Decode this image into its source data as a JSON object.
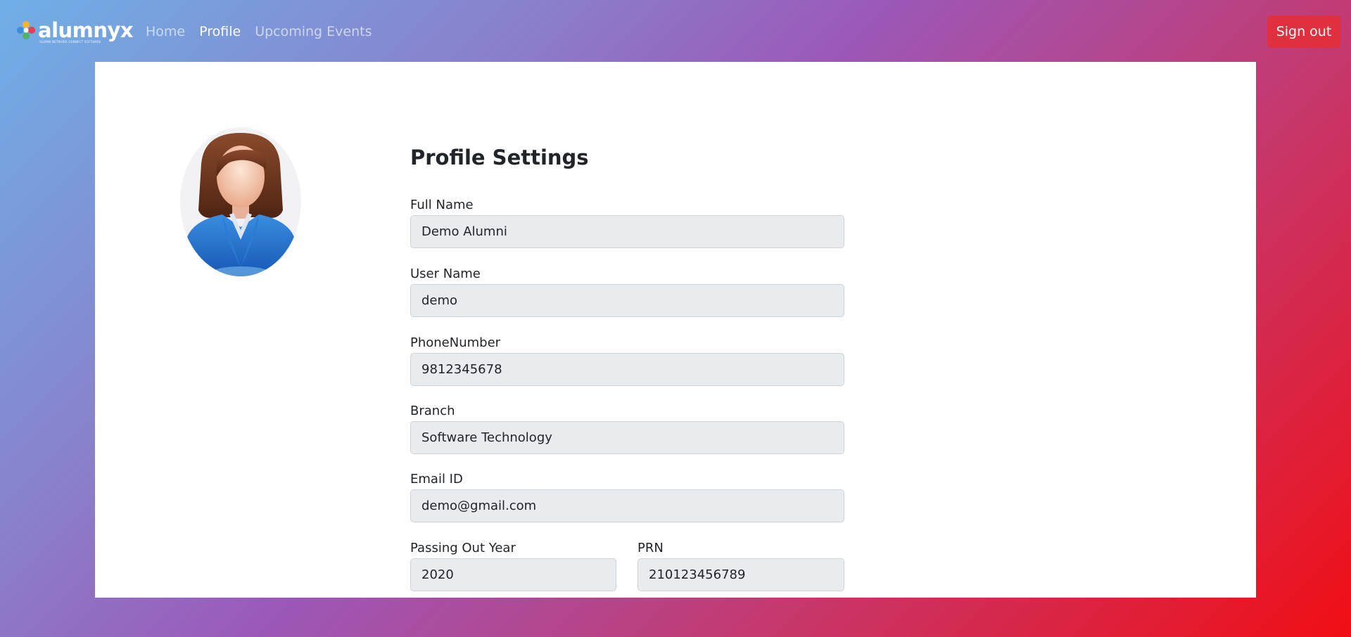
{
  "brand": {
    "name": "alumnyx",
    "tagline": "ALUMNI NETWORK CONNECT SOFTWARE"
  },
  "nav": {
    "links": [
      {
        "label": "Home",
        "active": false
      },
      {
        "label": "Profile",
        "active": true
      },
      {
        "label": "Upcoming Events",
        "active": false
      }
    ],
    "signout_label": "Sign out"
  },
  "profile": {
    "heading": "Profile Settings",
    "avatar_icon": "female-user-avatar-icon",
    "fields": {
      "full_name": {
        "label": "Full Name",
        "value": "Demo Alumni"
      },
      "user_name": {
        "label": "User Name",
        "value": "demo"
      },
      "phone": {
        "label": "PhoneNumber",
        "value": "9812345678"
      },
      "branch": {
        "label": "Branch",
        "value": "Software Technology"
      },
      "email": {
        "label": "Email ID",
        "value": "demo@gmail.com"
      },
      "passing_year": {
        "label": "Passing Out Year",
        "value": "2020"
      },
      "prn": {
        "label": "PRN",
        "value": "210123456789"
      }
    }
  },
  "colors": {
    "gradient_start": "#6fb0e6",
    "gradient_mid": "#9c58b8",
    "gradient_end": "#f10e14",
    "signout": "#e0303f",
    "input_bg": "#e9ecef"
  }
}
